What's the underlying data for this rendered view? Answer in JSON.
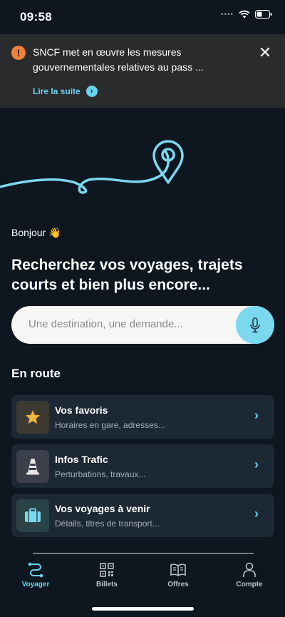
{
  "status_bar": {
    "time": "09:58"
  },
  "alert": {
    "icon": "warning-circle-icon",
    "text": "SNCF met en œuvre les mesures gouvernementales relatives au pass ...",
    "link_label": "Lire la suite",
    "close_icon": "close-icon",
    "accent_color": "#f0813b"
  },
  "greeting": "Bonjour 👋",
  "headline": "Recherchez vos voyages, trajets courts et bien plus encore...",
  "search": {
    "placeholder": "Une destination, une demande...",
    "mic_icon": "microphone-icon"
  },
  "section_title": "En route",
  "cards": [
    {
      "icon": "star-icon",
      "title": "Vos favoris",
      "subtitle": "Horaires en gare, adresses...",
      "icon_bg": "#3d3a33",
      "icon_color": "#f3b53f"
    },
    {
      "icon": "traffic-cone-icon",
      "title": "Infos Trafic",
      "subtitle": "Perturbations, travaux...",
      "icon_bg": "#3a3f4a",
      "icon_color": "#ffffff"
    },
    {
      "icon": "suitcase-icon",
      "title": "Vos voyages à venir",
      "subtitle": "Détails, titres de transport...",
      "icon_bg": "#2a4347",
      "icon_color": "#7ad8ef"
    }
  ],
  "tabs": [
    {
      "icon": "route-icon",
      "label": "Voyager",
      "active": true
    },
    {
      "icon": "qr-code-icon",
      "label": "Billets",
      "active": false
    },
    {
      "icon": "book-icon",
      "label": "Offres",
      "active": false
    },
    {
      "icon": "user-icon",
      "label": "Compte",
      "active": false
    }
  ],
  "colors": {
    "accent": "#68d3ee",
    "background": "#0e1620",
    "card": "#1d2835"
  }
}
